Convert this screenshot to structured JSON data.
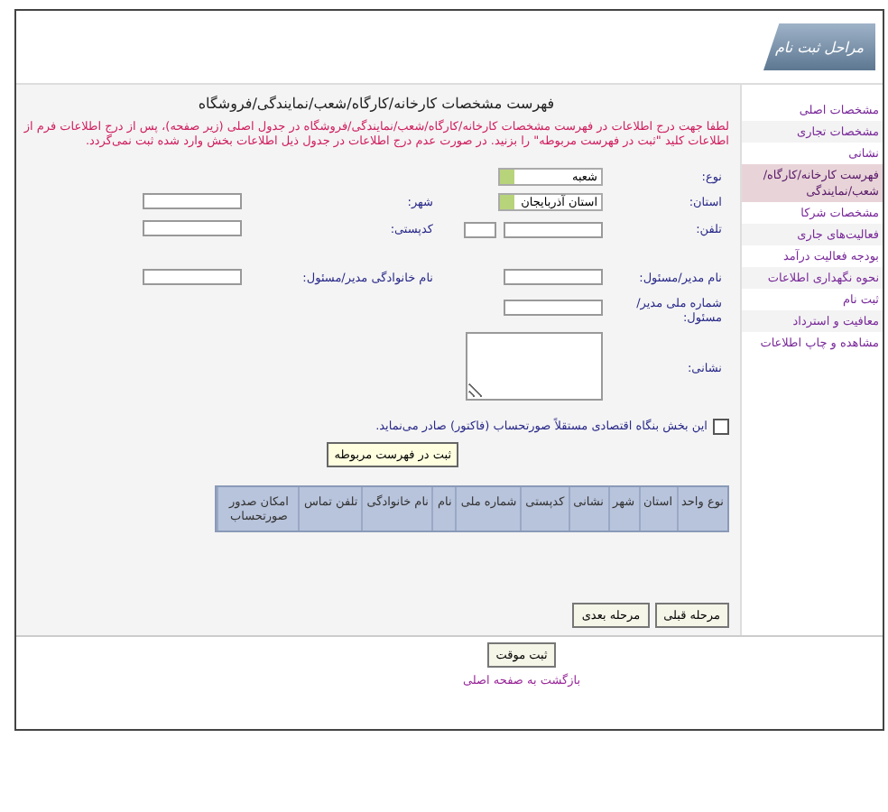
{
  "header": {
    "logo_text": "مراحل ثبت نام"
  },
  "sidebar": {
    "items": [
      {
        "label": "مشخصات اصلی",
        "selected": false
      },
      {
        "label": "مشخصات تجاری",
        "selected": false
      },
      {
        "label": "نشانی",
        "selected": false
      },
      {
        "label": "فهرست کارخانه/کارگاه/شعب/نمایندگی",
        "selected": true
      },
      {
        "label": "مشخصات شرکا",
        "selected": false
      },
      {
        "label": "فعالیت‌های جاری",
        "selected": false
      },
      {
        "label": "بودجه فعالیت درآمد",
        "selected": false
      },
      {
        "label": "نحوه نگهداری اطلاعات",
        "selected": false
      },
      {
        "label": "ثبت نام",
        "selected": false
      },
      {
        "label": "معافیت و استرداد",
        "selected": false
      },
      {
        "label": "مشاهده و چاپ اطلاعات",
        "selected": false
      }
    ]
  },
  "form": {
    "title": "فهرست مشخصات کارخانه/کارگاه/شعب/نمایندگی/فروشگاه",
    "notice": "لطفا جهت درج اطلاعات در فهرست مشخصات کارخانه/کارگاه/شعب/نمایندگی/فروشگاه در جدول اصلی (زیر صفحه)، پس از درج اطلاعات فرم از اطلاعات کلید \"ثبت در فهرست مربوطه\" را بزنید. در صورت عدم درج اطلاعات در جدول ذیل اطلاعات بخش وارد شده ثبت نمی‌گردد.",
    "rows": [
      [
        {
          "label": "نوع:",
          "kind": "select",
          "value": "شعبه"
        }
      ],
      [
        {
          "label": "استان:",
          "kind": "select",
          "value": "استان آذربایجان"
        },
        {
          "label": "شهر:",
          "kind": "text"
        }
      ],
      [
        {
          "label": "تلفن:",
          "kind": "phone"
        },
        {
          "label": "کدپستی:",
          "kind": "text"
        }
      ],
      [
        {
          "label": "نام مدیر/مسئول:",
          "kind": "text"
        },
        {
          "label": "نام خانوادگی مدیر/مسئول:",
          "kind": "text"
        }
      ],
      [
        {
          "label": "شماره ملی مدیر/مسئول:",
          "kind": "text"
        }
      ],
      [
        {
          "label": "نشانی:",
          "kind": "textarea"
        }
      ]
    ],
    "invoice_checkbox": {
      "label": "این بخش بنگاه اقتصادی مستقلاً صورتحساب (فاکتور) صادر می‌نماید.",
      "checked": false
    },
    "add_button": "ثبت در فهرست مربوطه",
    "table": {
      "columns": [
        "نوع واحد",
        "استان",
        "شهر",
        "نشانی",
        "کدپستی",
        "شماره ملی",
        "نام",
        "نام خانوادگی",
        "تلفن تماس",
        "امکان صدور صورتحساب"
      ]
    },
    "nav_buttons": [
      "مرحله قبلی",
      "مرحله بعدی"
    ]
  },
  "footer": {
    "save_button": "ثبت موقت",
    "back_link": "بازگشت به صفحه اصلی"
  }
}
